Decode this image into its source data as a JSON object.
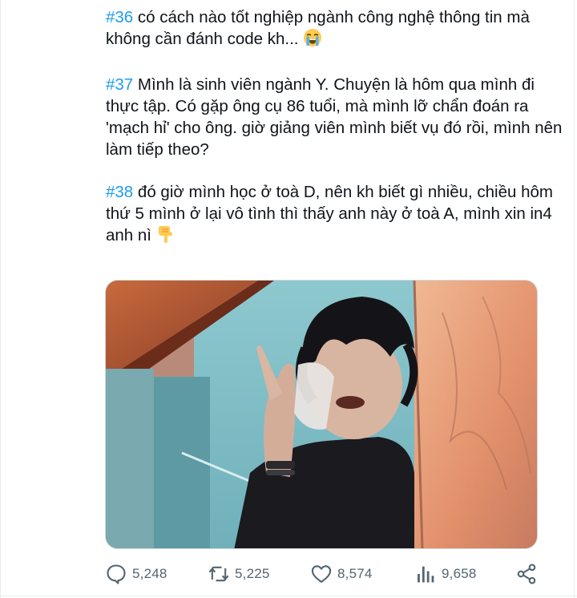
{
  "tweets": [
    {
      "tag": "#36",
      "text": " có cách nào tốt nghiệp ngành công nghệ thông tin mà không cần đánh code kh...",
      "emoji": "loudly-crying-face-emoji"
    },
    {
      "tag": "#37",
      "text": " Mình là sinh viên ngành Y. Chuyện là hôm qua mình đi thực tập. Có gặp ông cụ 86 tuổi, mà mình lỡ chẩn đoán ra 'mạch hỉ' cho ông. giờ giảng viên mình biết vụ đó rồi, mình nên làm tiếp theo?"
    },
    {
      "tag": "#38",
      "text": " đó giờ mình học ở toà D, nên kh biết gì nhiều, chiều hôm thứ 5 mình ở lại vô tình thì thấy anh này ở toà A, mình xin in4 anh nì ",
      "emoji": "backhand-index-pointing-down-emoji"
    }
  ],
  "media": {
    "type": "photo",
    "icon": "photo-of-person-at-window"
  },
  "actions": {
    "replies": "5,248",
    "retweets": "5,225",
    "likes": "8,574",
    "views": "9,658"
  },
  "icons": {
    "reply": "reply-icon",
    "retweet": "retweet-icon",
    "like": "heart-icon",
    "views": "views-chart-icon",
    "share": "share-icon"
  },
  "colors": {
    "hashtag": "#1d9bf0",
    "action_gray": "#536471"
  }
}
